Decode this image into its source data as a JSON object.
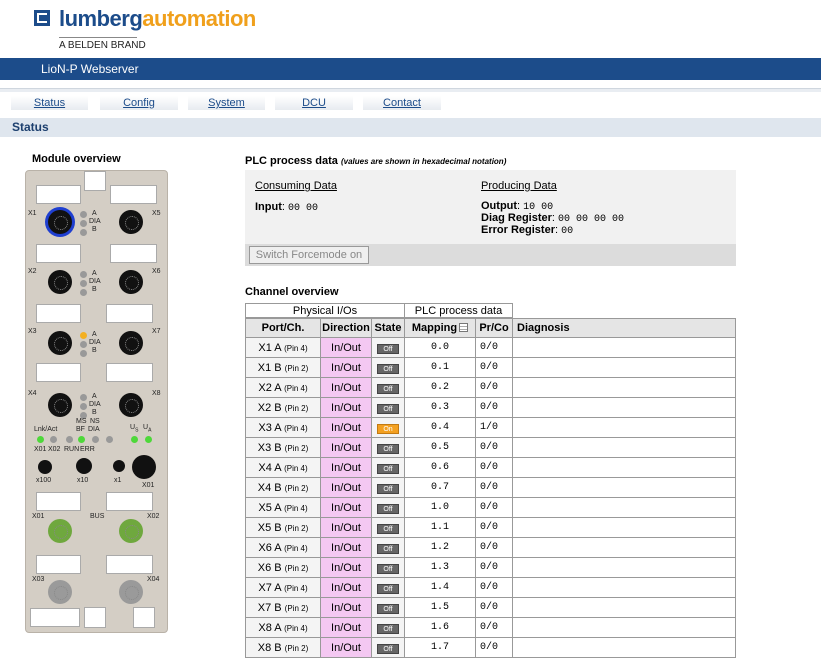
{
  "logo": {
    "brand1": "lumberg",
    "brand2": "automation",
    "sub": "A BELDEN BRAND",
    "icon": "la-logo-icon"
  },
  "app_title": "LioN-P Webserver",
  "tabs": [
    "Status",
    "Config",
    "System",
    "DCU",
    "Contact"
  ],
  "section_title": "Status",
  "module_overview": {
    "title": "Module overview",
    "ports": [
      "X1",
      "X2",
      "X3",
      "X4",
      "X5",
      "X6",
      "X7",
      "X8"
    ],
    "led_letters": {
      "a": "A",
      "dia": "DIA",
      "b": "B"
    },
    "status_labels": {
      "lnk": "Lnk/Act",
      "x01": "X01",
      "x02": "X02",
      "ms": "MS",
      "bf": "BF",
      "ns": "NS",
      "dia": "DIA",
      "run": "RUN",
      "err": "ERR",
      "us": "U",
      "us_sub": "S",
      "ua": "U",
      "ua_sub": "A"
    },
    "rotary": [
      "x100",
      "x10",
      "x1"
    ],
    "bus_label": "BUS",
    "bus_ports": [
      "X01",
      "X02",
      "X03",
      "X04"
    ]
  },
  "plc": {
    "title": "PLC process data",
    "note": "(values are shown in hexadecimal notation)",
    "consuming": {
      "title": "Consuming Data",
      "input_label": "Input",
      "input_value": "00 00"
    },
    "producing": {
      "title": "Producing Data",
      "output_label": "Output",
      "output_value": "10 00",
      "diag_label": "Diag Register",
      "diag_value": "00 00 00 00",
      "error_label": "Error Register",
      "error_value": "00"
    },
    "force_button": "Switch Forcemode on"
  },
  "channel": {
    "title": "Channel overview",
    "groups": [
      "Physical I/Os",
      "PLC process data"
    ],
    "headers": [
      "Port/Ch.",
      "Direction",
      "State",
      "Mapping",
      "Pr/Co",
      "Diagnosis"
    ],
    "rows": [
      {
        "port": "X1 A",
        "pin": "(Pin 4)",
        "dir": "In/Out",
        "state": "Off",
        "map": "0.0",
        "prco": "0/0"
      },
      {
        "port": "X1 B",
        "pin": "(Pin 2)",
        "dir": "In/Out",
        "state": "Off",
        "map": "0.1",
        "prco": "0/0"
      },
      {
        "port": "X2 A",
        "pin": "(Pin 4)",
        "dir": "In/Out",
        "state": "Off",
        "map": "0.2",
        "prco": "0/0"
      },
      {
        "port": "X2 B",
        "pin": "(Pin 2)",
        "dir": "In/Out",
        "state": "Off",
        "map": "0.3",
        "prco": "0/0"
      },
      {
        "port": "X3 A",
        "pin": "(Pin 4)",
        "dir": "In/Out",
        "state": "On",
        "map": "0.4",
        "prco": "1/0"
      },
      {
        "port": "X3 B",
        "pin": "(Pin 2)",
        "dir": "In/Out",
        "state": "Off",
        "map": "0.5",
        "prco": "0/0"
      },
      {
        "port": "X4 A",
        "pin": "(Pin 4)",
        "dir": "In/Out",
        "state": "Off",
        "map": "0.6",
        "prco": "0/0"
      },
      {
        "port": "X4 B",
        "pin": "(Pin 2)",
        "dir": "In/Out",
        "state": "Off",
        "map": "0.7",
        "prco": "0/0"
      },
      {
        "port": "X5 A",
        "pin": "(Pin 4)",
        "dir": "In/Out",
        "state": "Off",
        "map": "1.0",
        "prco": "0/0"
      },
      {
        "port": "X5 B",
        "pin": "(Pin 2)",
        "dir": "In/Out",
        "state": "Off",
        "map": "1.1",
        "prco": "0/0"
      },
      {
        "port": "X6 A",
        "pin": "(Pin 4)",
        "dir": "In/Out",
        "state": "Off",
        "map": "1.2",
        "prco": "0/0"
      },
      {
        "port": "X6 B",
        "pin": "(Pin 2)",
        "dir": "In/Out",
        "state": "Off",
        "map": "1.3",
        "prco": "0/0"
      },
      {
        "port": "X7 A",
        "pin": "(Pin 4)",
        "dir": "In/Out",
        "state": "Off",
        "map": "1.4",
        "prco": "0/0"
      },
      {
        "port": "X7 B",
        "pin": "(Pin 2)",
        "dir": "In/Out",
        "state": "Off",
        "map": "1.5",
        "prco": "0/0"
      },
      {
        "port": "X8 A",
        "pin": "(Pin 4)",
        "dir": "In/Out",
        "state": "Off",
        "map": "1.6",
        "prco": "0/0"
      },
      {
        "port": "X8 B",
        "pin": "(Pin 2)",
        "dir": "In/Out",
        "state": "Off",
        "map": "1.7",
        "prco": "0/0"
      }
    ]
  },
  "colors": {
    "brand_blue": "#1c4c8a",
    "brand_orange": "#f0a01c",
    "direction_bg": "#f4c8f2",
    "state_on": "#f3a020",
    "state_off": "#666666",
    "led_green": "#4ed83a",
    "led_yellow": "#f3b022"
  }
}
